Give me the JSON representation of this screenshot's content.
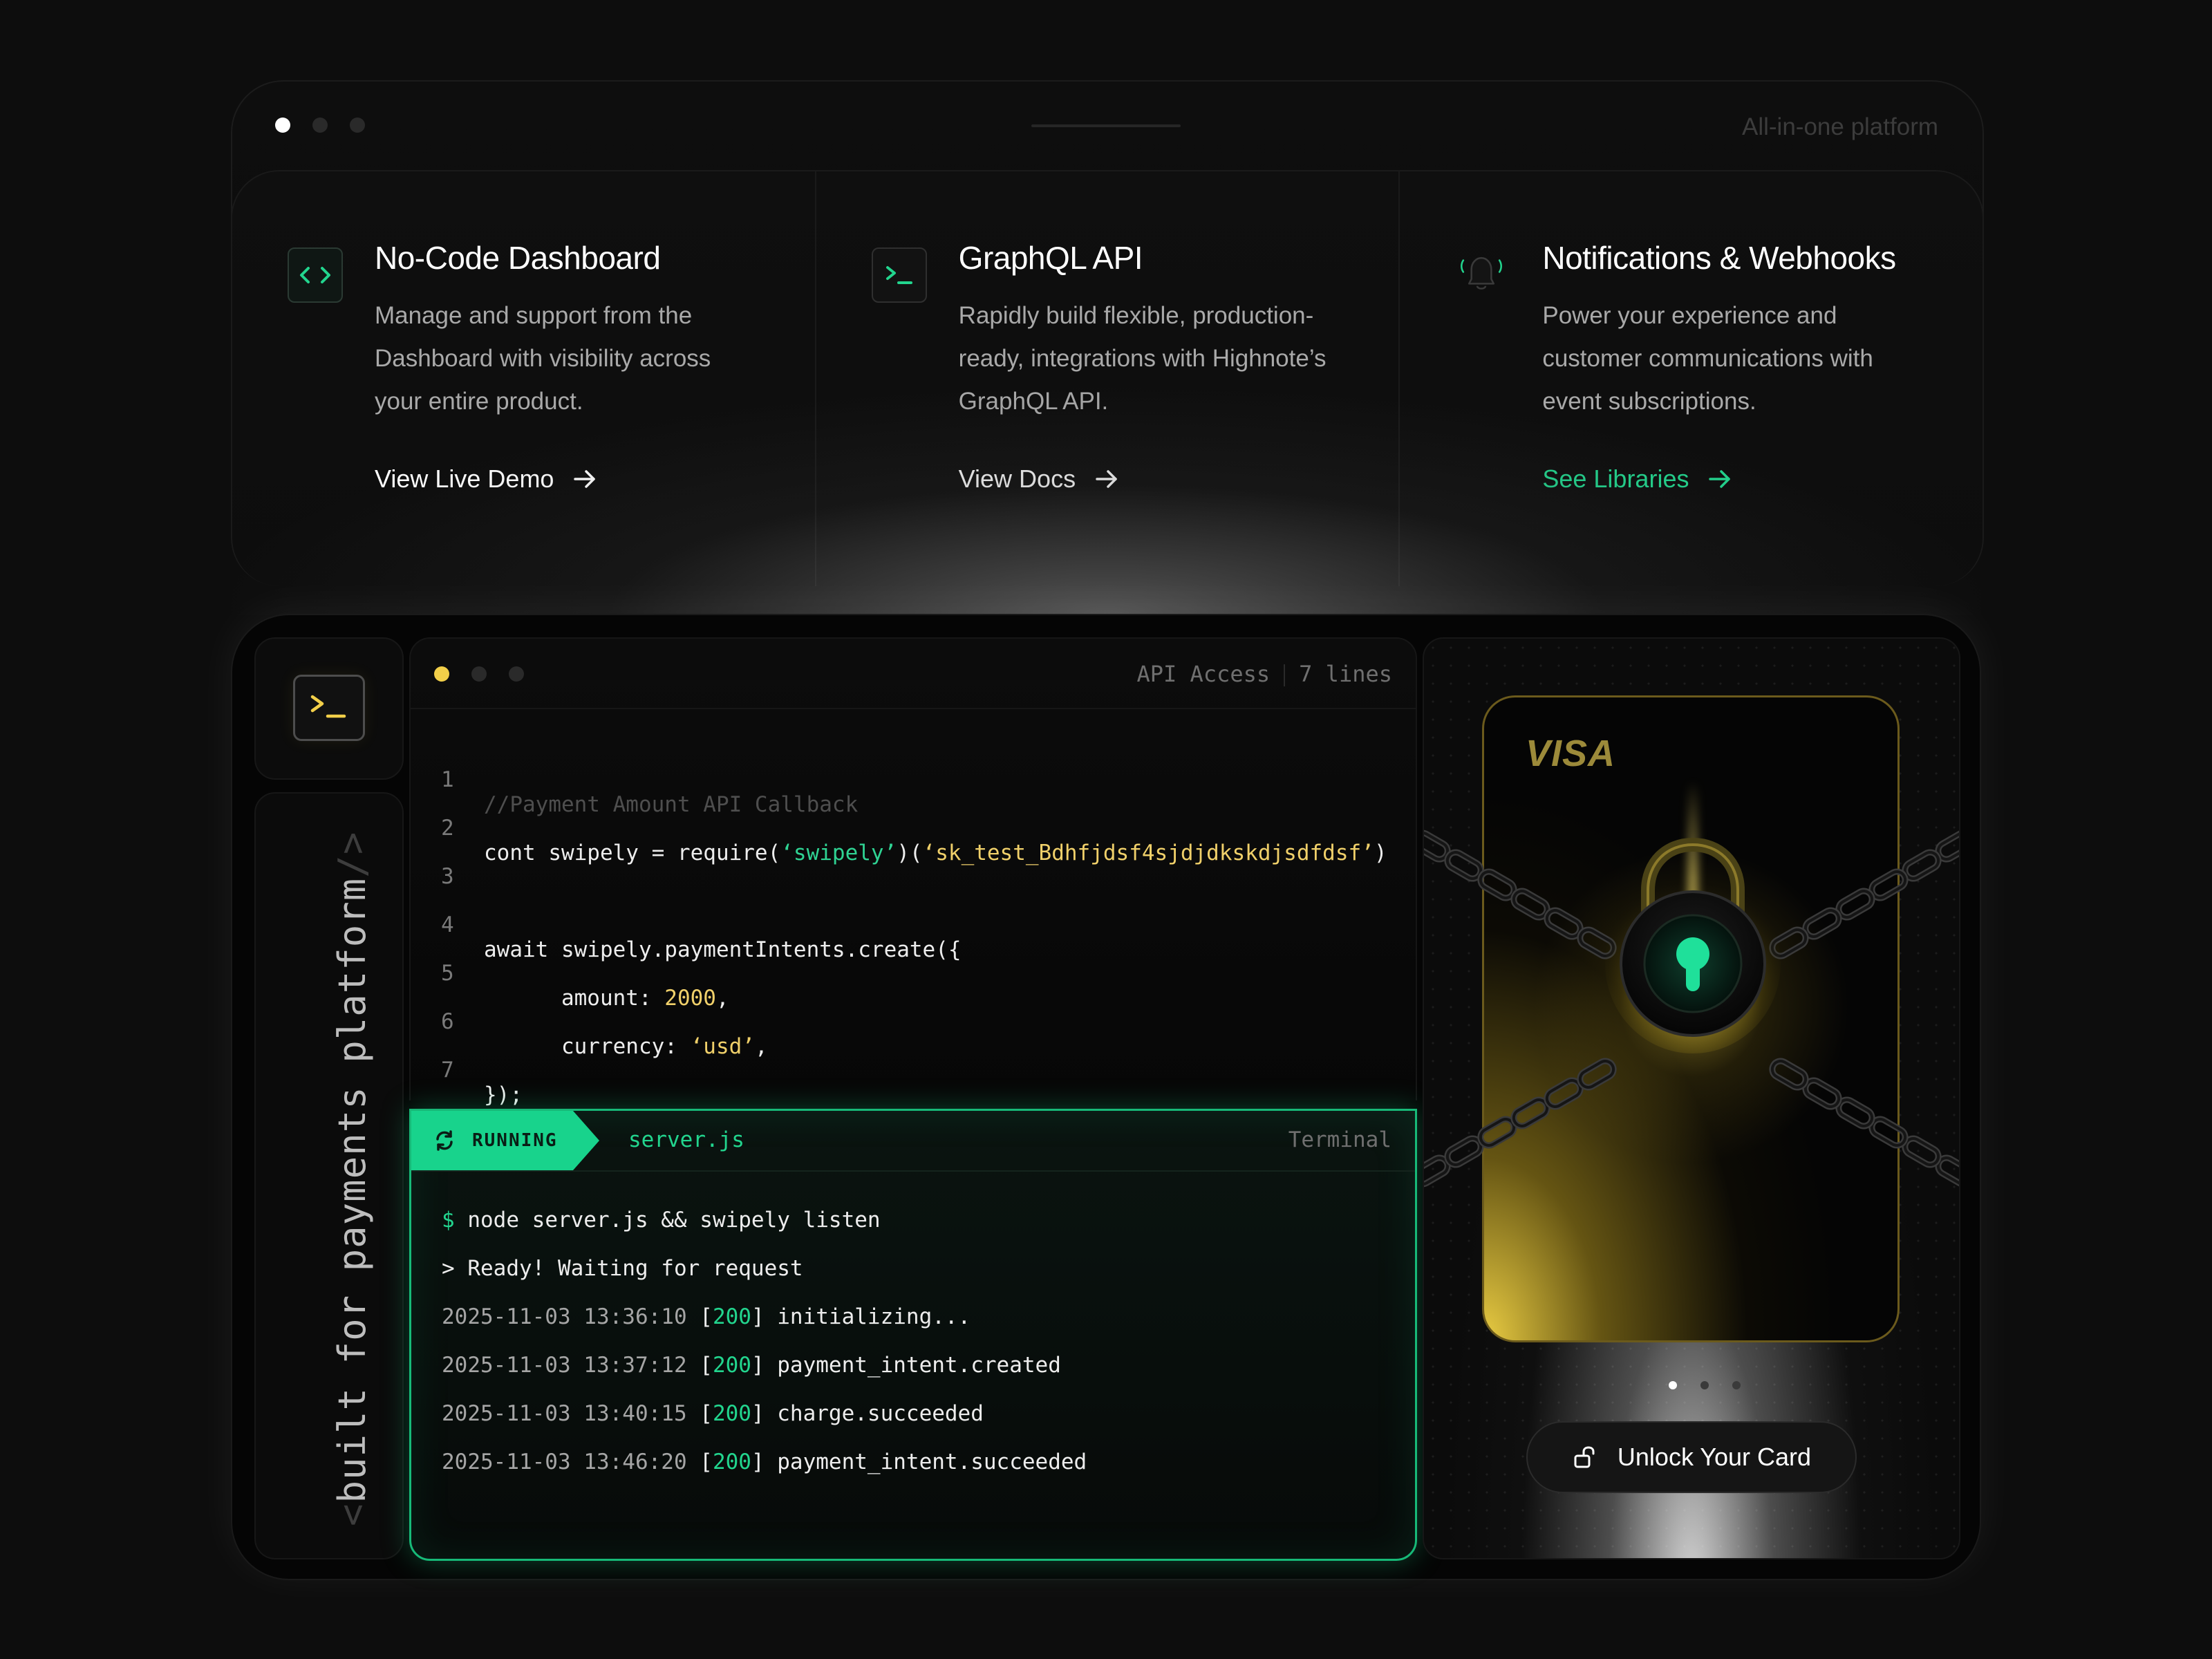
{
  "top": {
    "tagline": "All-in-one platform",
    "features": [
      {
        "icon": "code-brackets-icon",
        "title": "No-Code Dashboard",
        "description": "Manage and support from the Dashboard with visibility across your entire product.",
        "link": "View Live Demo",
        "link_color": "#ffffff"
      },
      {
        "icon": "terminal-icon",
        "title": "GraphQL API",
        "description": "Rapidly build flexible, production-ready, integrations with Highnote’s GraphQL API.",
        "link": "View Docs",
        "link_color": "#ffffff"
      },
      {
        "icon": "bell-icon",
        "title": "Notifications & Webhooks",
        "description": "Power your experience and customer communications with event subscriptions.",
        "link": "See Libraries",
        "link_color": "#22d58e"
      }
    ]
  },
  "sidebar": {
    "icon": "terminal-icon",
    "vertical_text_open": "<",
    "vertical_text": "built for payments platform",
    "vertical_text_close": "/>"
  },
  "editor": {
    "section": "API Access",
    "line_count": "7 lines",
    "lines": [
      {
        "n": "1",
        "text": "//Payment Amount API Callback"
      },
      {
        "n": "2",
        "text": "cont swipely = require(‘swipely’)(‘sk_test_Bdhfjdsf4sjdjdkskdjsdfdsf’)"
      },
      {
        "n": "3",
        "text": ""
      },
      {
        "n": "4",
        "text": "await swipely.paymentIntents.create({"
      },
      {
        "n": "5",
        "text": "      amount: 2000,"
      },
      {
        "n": "6",
        "text": "      currency: ‘usd’,"
      },
      {
        "n": "7",
        "text": "});"
      }
    ]
  },
  "terminal": {
    "status": "RUNNING",
    "file": "server.js",
    "label": "Terminal",
    "command_prompt": "$",
    "command": " node server.js && swipely listen",
    "ready": "> Ready! Waiting for request",
    "logs": [
      {
        "ts": "2025-11-03 13:36:10",
        "code": "200",
        "event": "initializing..."
      },
      {
        "ts": "2025-11-03 13:37:12",
        "code": "200",
        "event": "payment_intent.created"
      },
      {
        "ts": "2025-11-03 13:40:15",
        "code": "200",
        "event": "charge.succeeded"
      },
      {
        "ts": "2025-11-03 13:46:20",
        "code": "200",
        "event": "payment_intent.succeeded"
      }
    ]
  },
  "card": {
    "brand": "VISA",
    "carousel_total": 3,
    "carousel_active": 1,
    "unlock_label": "Unlock Your Card",
    "accent": "#f2cf49",
    "lock_accent": "#1fe09a"
  },
  "colors": {
    "green": "#22d58e",
    "yellow": "#f2cf49"
  }
}
